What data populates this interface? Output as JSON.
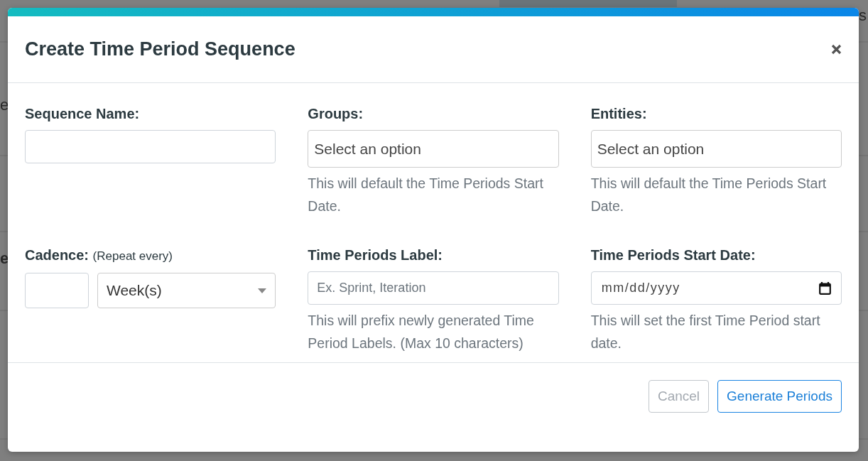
{
  "background": {
    "fragments": [
      {
        "text": "e",
        "bold": false
      },
      {
        "text": "e",
        "bold": true
      },
      {
        "text": "s",
        "bold": false
      }
    ]
  },
  "dialog": {
    "title": "Create Time Period Sequence",
    "fields": [
      {
        "kind": "text",
        "label": "Sequence Name:"
      },
      {
        "kind": "select",
        "label": "Groups:",
        "placeholder": "Select an option",
        "help": "This will default the Time Periods Start Date."
      },
      {
        "kind": "select",
        "label": "Entities:",
        "placeholder": "Select an option",
        "help": "This will default the Time Periods Start Date."
      },
      {
        "kind": "cadence",
        "label": "Cadence:",
        "note": "(Repeat every)",
        "unit": "Week(s)"
      },
      {
        "kind": "text",
        "label": "Time Periods Label:",
        "placeholder": "Ex. Sprint, Iteration",
        "help": "This will prefix newly generated Time Period Labels. (Max 10 characters)"
      },
      {
        "kind": "date",
        "label": "Time Periods Start Date:",
        "placeholder": "mm/dd/yyyy",
        "help": "This will set the first Time Period start date."
      }
    ],
    "buttons": [
      {
        "label": "Cancel",
        "kind": "secondary"
      },
      {
        "label": "Generate Periods",
        "kind": "primary"
      }
    ]
  }
}
